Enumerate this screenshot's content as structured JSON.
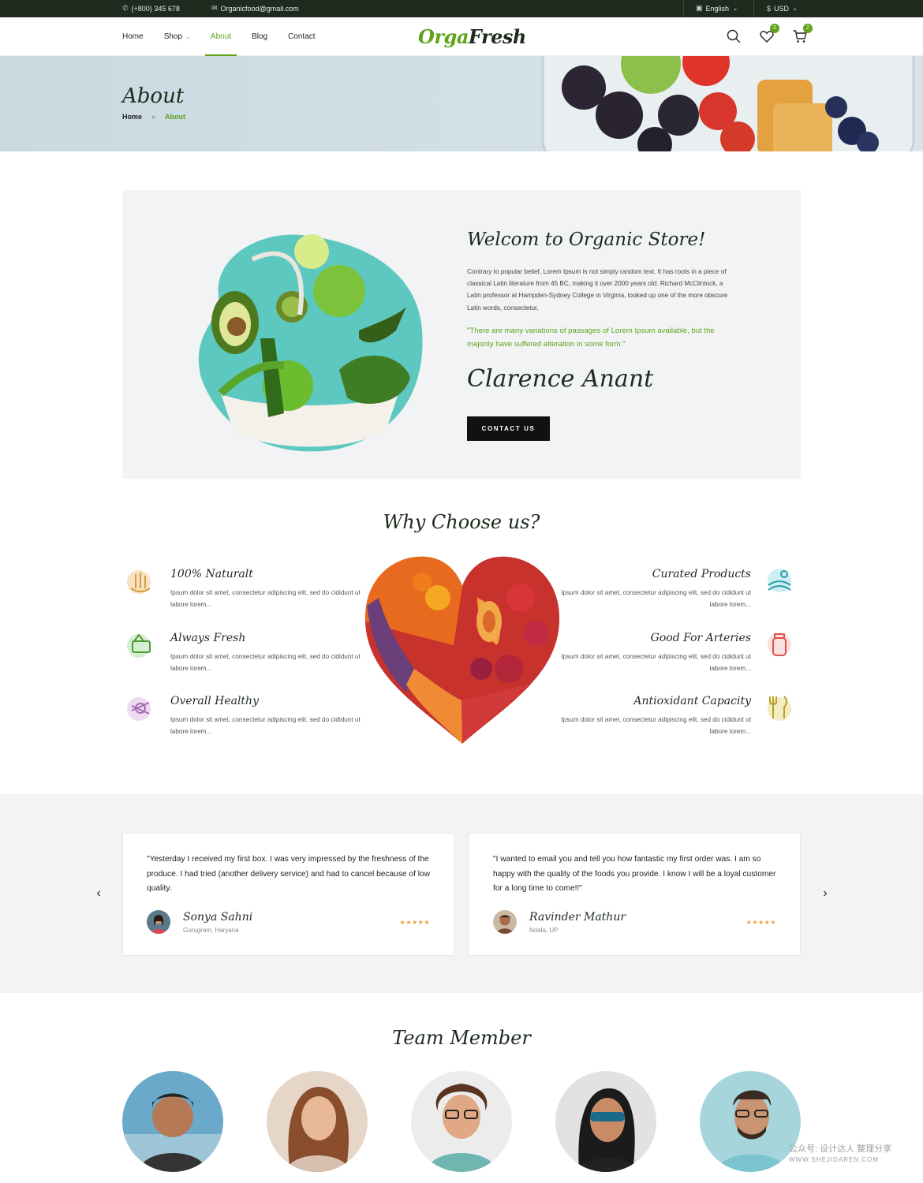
{
  "topbar": {
    "phone": "(+800) 345 678",
    "email": "Organicfood@gmail.com",
    "language": "English",
    "currency": "USD"
  },
  "nav": {
    "items": [
      {
        "label": "Home",
        "active": false,
        "has_menu": false
      },
      {
        "label": "Shop",
        "active": false,
        "has_menu": true
      },
      {
        "label": "About",
        "active": true,
        "has_menu": false
      },
      {
        "label": "Blog",
        "active": false,
        "has_menu": false
      },
      {
        "label": "Contact",
        "active": false,
        "has_menu": false
      }
    ],
    "logo_part1": "Orga",
    "logo_part2": "Fresh",
    "wishlist_count": "2",
    "cart_count": "2"
  },
  "hero": {
    "title": "About",
    "breadcrumb_home": "Home",
    "breadcrumb_sep": "»",
    "breadcrumb_current": "About"
  },
  "about": {
    "title": "Welcom to Organic Store!",
    "body": "Contrary to popular belief, Lorem Ipsum is not simply random text. It has roots in a piece of classical Latin literature from 45 BC, making it over 2000 years old. Richard McClintock, a Latin professor at Hampden-Sydney College in Virginia, looked up one of the more obscure Latin words, consectetur,",
    "quote": "\"There are many variations of passages of Lorem Ipsum available, but the majority have suffered alteration in some form.\"",
    "signature": "Clarence Anant",
    "button": "CONTACT US"
  },
  "why": {
    "title": "Why  Choose us?",
    "features_left": [
      {
        "title": "100% Naturalt",
        "desc": "Ipsum dolor sit amet, consectetur adipiscing elit, sed do cididunt ut labore lorem...",
        "icon": "wheat-hand-icon"
      },
      {
        "title": "Always Fresh",
        "desc": "Ipsum dolor sit amet, consectetur adipiscing elit, sed do cididunt ut labore lorem...",
        "icon": "fresh-basket-icon"
      },
      {
        "title": "Overall Healthy",
        "desc": "Ipsum dolor sit amet, consectetur adipiscing elit, sed do cididunt ut labore lorem...",
        "icon": "healthy-food-icon"
      }
    ],
    "features_right": [
      {
        "title": "Curated Products",
        "desc": "Ipsum dolor sit amet, consectetur adipiscing elit, sed do cididunt ut labore lorem...",
        "icon": "field-icon"
      },
      {
        "title": "Good For Arteries",
        "desc": "Ipsum dolor sit amet, consectetur adipiscing elit, sed do cididunt ut labore lorem...",
        "icon": "jar-icon"
      },
      {
        "title": "Antioxidant Capacity",
        "desc": "Ipsum dolor sit amet, consectetur adipiscing elit, sed do cididunt ut labore lorem...",
        "icon": "cutlery-icon"
      }
    ]
  },
  "testimonials": [
    {
      "quote": "\"Yesterday I received my first box. I was very impressed by the freshness of the produce. I had tried (another delivery service) and had to cancel because of low quality.",
      "name": "Sonya Sahni",
      "location": "Gurugram, Haryana",
      "stars": "★★★★★",
      "rating": 5
    },
    {
      "quote": "\"I wanted to email you and tell you how fantastic my first order was. I am so happy with the quality of the foods you provide. I know I will be a loyal customer for a long time to come!!\"",
      "name": "Ravinder Mathur",
      "location": "Noida, UP",
      "stars": "★★★★★",
      "rating": 5
    }
  ],
  "carousel": {
    "prev": "‹",
    "next": "›"
  },
  "team": {
    "title": "Team Member",
    "count": 5
  },
  "watermark": {
    "line1": "公众号: 设计达人 整理分享",
    "line2": "WWW.SHEJIDAREN.COM"
  },
  "colors": {
    "accent": "#5fa319",
    "dark": "#1f2a1f",
    "panel": "#f2f3f4",
    "star": "#e8a33a"
  }
}
